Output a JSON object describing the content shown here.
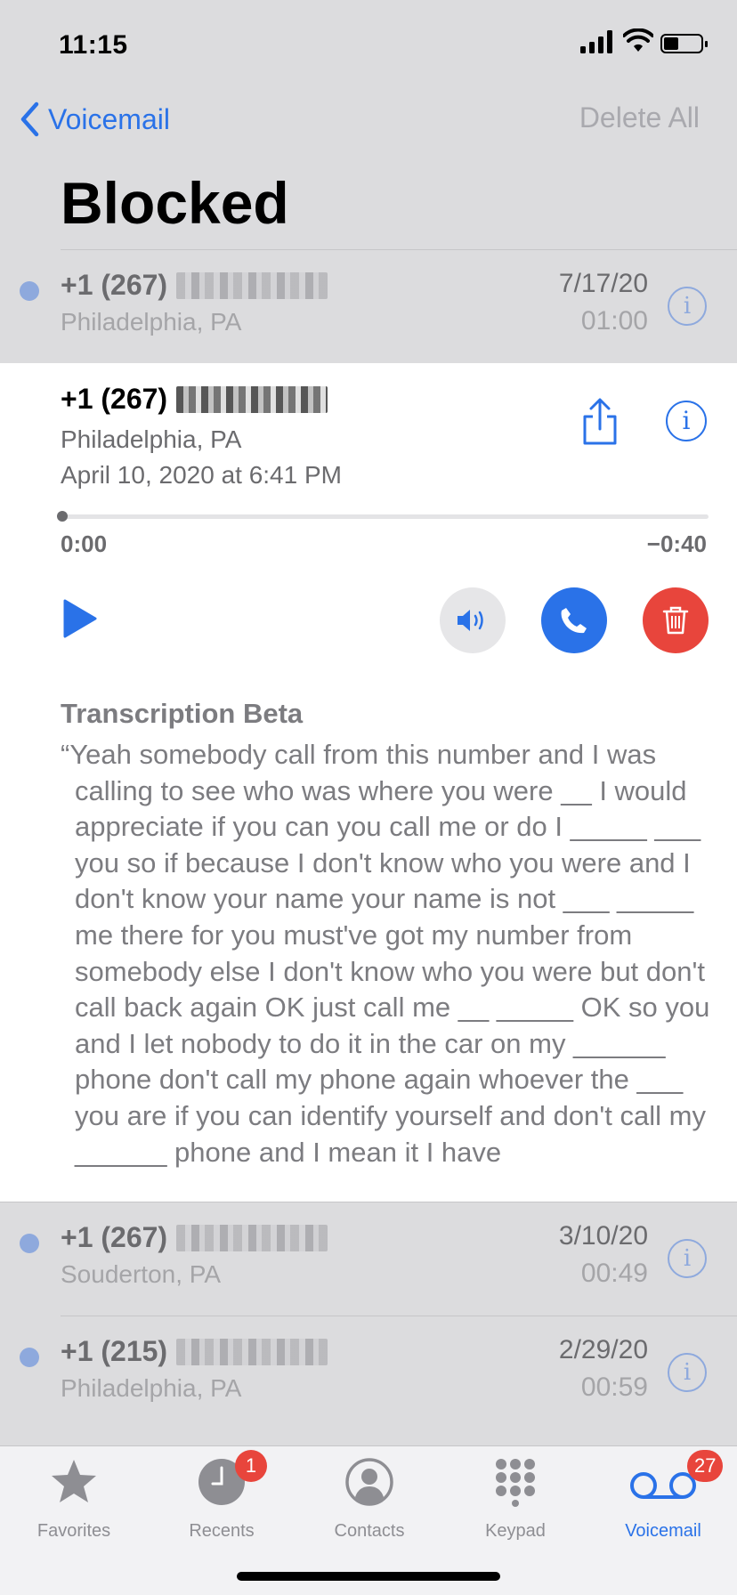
{
  "status_bar": {
    "time": "11:15"
  },
  "nav": {
    "back_label": "Voicemail",
    "delete_all_label": "Delete All",
    "title": "Blocked"
  },
  "voicemails": [
    {
      "number": "+1 (267)",
      "location": "Philadelphia, PA",
      "date": "7/17/20",
      "duration": "01:00",
      "unread": true
    }
  ],
  "expanded": {
    "number": "+1 (267)",
    "location": "Philadelphia, PA",
    "datetime": "April 10, 2020 at 6:41 PM",
    "elapsed": "0:00",
    "remaining": "−0:40",
    "progress": 0,
    "transcription_heading": "Transcription Beta",
    "transcription": "“Yeah somebody call from this number and I was calling to see who was where you were __ I would appreciate if you can you call me or do I _____ ___ you so if because I don't know who you were and I don't know your name your name is not ___ _____ me there for you must've got my number from somebody else I don't know who you were but don't call back again OK just call me __ _____ OK so you and I let nobody to do it in the car on my ______ phone don't call my phone again whoever the ___ you are if you can identify yourself and don't call my ______ phone and I mean it I have"
  },
  "voicemails_below": [
    {
      "number": "+1 (267)",
      "location": "Souderton, PA",
      "date": "3/10/20",
      "duration": "00:49",
      "unread": true
    },
    {
      "number": "+1 (215)",
      "location": "Philadelphia, PA",
      "date": "2/29/20",
      "duration": "00:59",
      "unread": true
    }
  ],
  "tabs": [
    {
      "label": "Favorites",
      "icon": "star-icon",
      "badge": ""
    },
    {
      "label": "Recents",
      "icon": "clock-icon",
      "badge": "1"
    },
    {
      "label": "Contacts",
      "icon": "person-circle-icon",
      "badge": ""
    },
    {
      "label": "Keypad",
      "icon": "keypad-icon",
      "badge": ""
    },
    {
      "label": "Voicemail",
      "icon": "voicemail-icon",
      "badge": "27",
      "active": true
    }
  ],
  "colors": {
    "accent": "#2a72e8",
    "delete": "#e8453c",
    "unread_dot": "#8ea9dd"
  }
}
